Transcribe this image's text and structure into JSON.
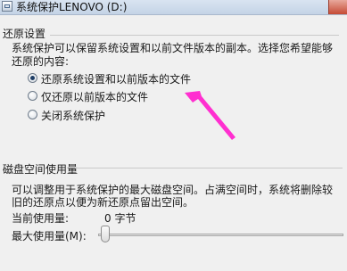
{
  "window": {
    "title": "系统保护LENOVO (D:)"
  },
  "restore_settings": {
    "heading": "还原设置",
    "description_line1": "系统保护可以保留系统设置和以前文件版本的副本。选择您希望能够",
    "description_line2": "还原的内容:",
    "options": [
      {
        "label": "还原系统设置和以前版本的文件",
        "selected": true
      },
      {
        "label": "仅还原以前版本的文件",
        "selected": false
      },
      {
        "label": "关闭系统保护",
        "selected": false
      }
    ]
  },
  "disk_space": {
    "heading": "磁盘空间使用量",
    "description_line1": "可以调整用于系统保护的最大磁盘空间。占满空间时，系统将删除较",
    "description_line2": "旧的还原点以便为新还原点留出空间。",
    "current_usage_label": "当前使用量:",
    "current_usage_value": "0 字节",
    "max_usage_label": "最大使用量(M):",
    "max_usage_fraction": 0
  },
  "annotation": {
    "arrow_color": "#ff2fd0"
  }
}
